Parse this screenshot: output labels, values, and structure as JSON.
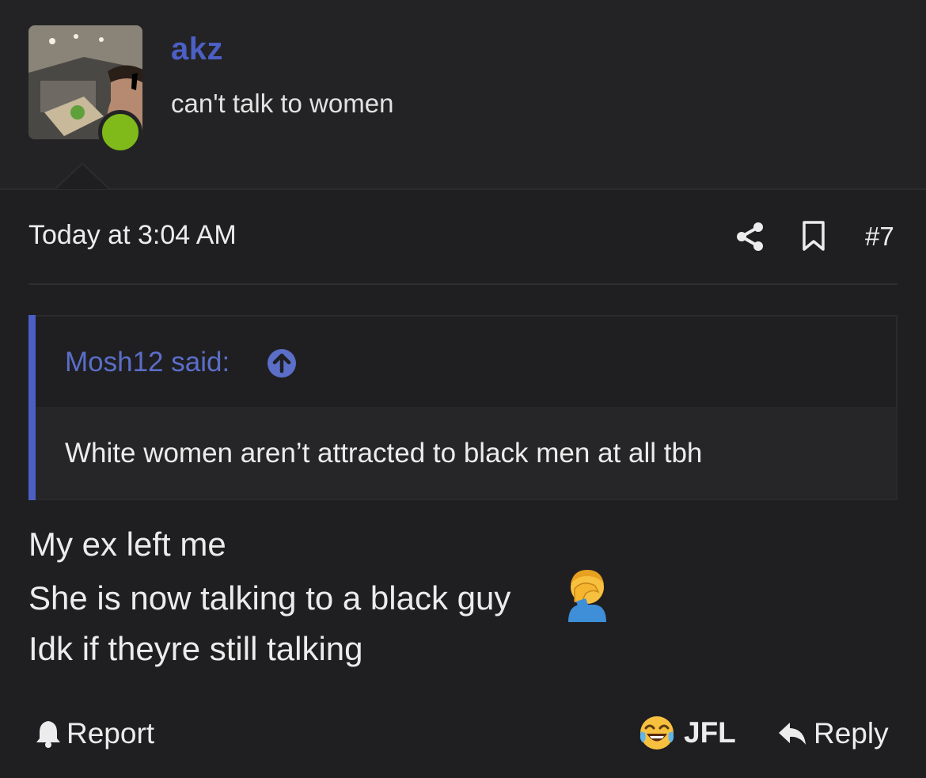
{
  "author": {
    "username": "akz",
    "user_title": "can't talk to women",
    "avatar_icon": "user-avatar-photo",
    "status_color": "#7fba1a"
  },
  "post_meta": {
    "date": "Today at 3:04 AM",
    "share_icon": "share-icon",
    "bookmark_icon": "bookmark-icon",
    "post_number": "#7"
  },
  "quote": {
    "author_label": "Mosh12 said:",
    "jump_icon": "arrow-up-circle-icon",
    "text": "White women aren’t attracted to black men at all tbh"
  },
  "message": {
    "lines": [
      "My ex left me",
      "She is now talking to a black guy",
      "Idk if theyre still talking"
    ],
    "inline_emoji": "man-facepalming"
  },
  "actions": {
    "report_label": "Report",
    "reaction_label": "JFL",
    "reaction_emoji": "face-with-tears-of-joy",
    "reply_label": "Reply"
  },
  "colors": {
    "accent": "#4c5fc4",
    "background": "#1f1f21",
    "header_background": "#232325",
    "online": "#7fba1a"
  }
}
